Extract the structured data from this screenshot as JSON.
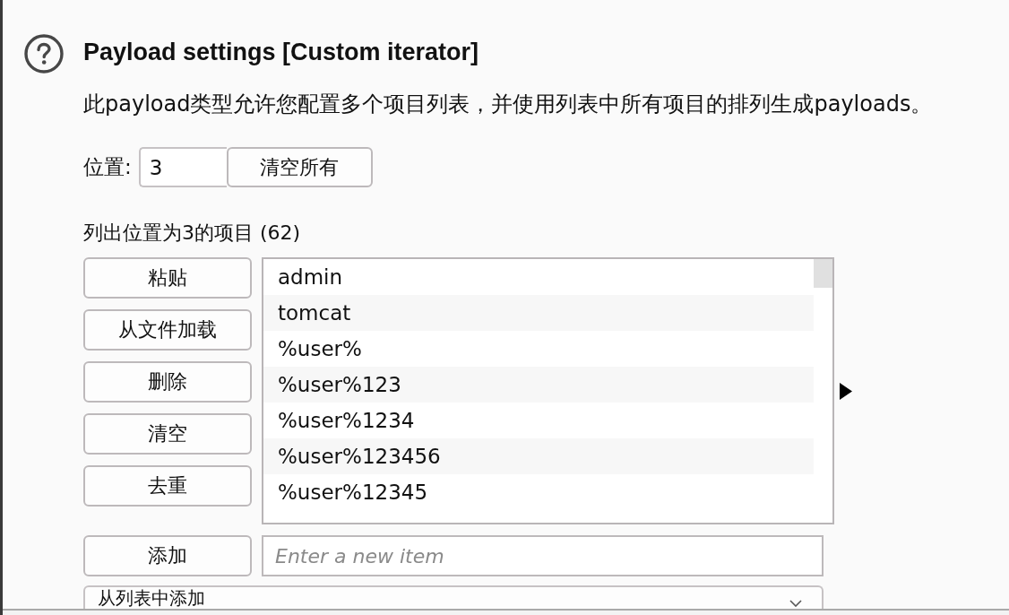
{
  "header": {
    "title": "Payload settings [Custom iterator]",
    "description": "此payload类型允许您配置多个项目列表，并使用列表中所有项目的排列生成payloads。"
  },
  "position": {
    "label": "位置:",
    "value": "3",
    "clear_all_button": "清空所有"
  },
  "list": {
    "heading": "列出位置为3的项目 (62)",
    "buttons": [
      "粘贴",
      "从文件加载",
      "删除",
      "清空",
      "去重"
    ],
    "items": [
      {
        "text": "admin",
        "selected": false
      },
      {
        "text": "tomcat",
        "selected": false
      },
      {
        "text": "%user%",
        "selected": false
      },
      {
        "text": "%user%123",
        "selected": false
      },
      {
        "text": "%user%1234",
        "selected": false
      },
      {
        "text": "%user%123456",
        "selected": false
      },
      {
        "text": "%user%12345",
        "selected": false
      }
    ]
  },
  "add": {
    "button": "添加",
    "placeholder": "Enter a new item"
  },
  "add_from_list": {
    "value": "从列表中添加"
  }
}
